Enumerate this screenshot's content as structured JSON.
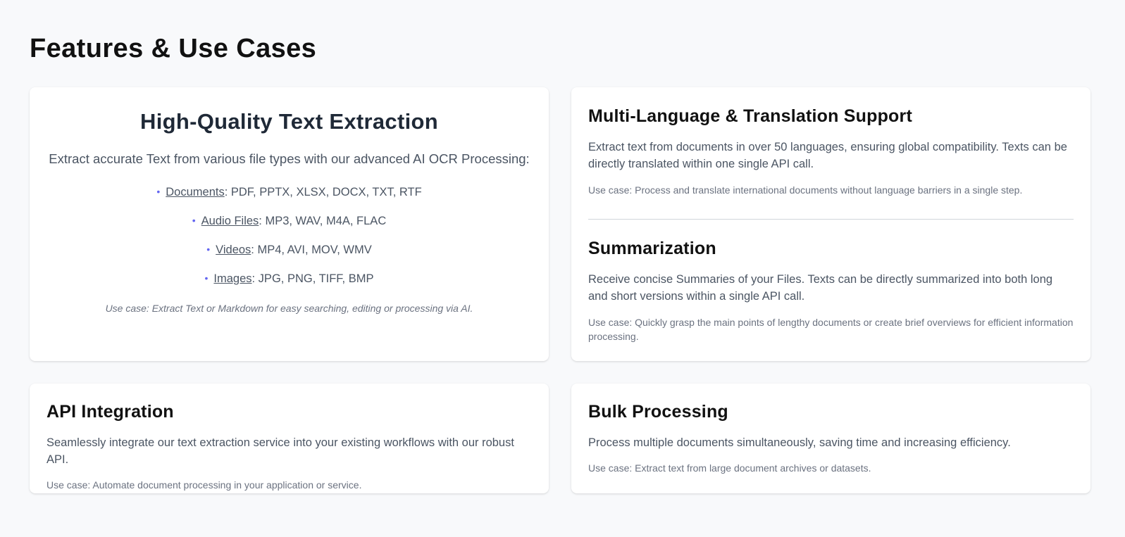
{
  "page": {
    "title": "Features & Use Cases"
  },
  "text_extraction": {
    "title": "High-Quality Text Extraction",
    "description": "Extract accurate Text from various file types with our advanced AI OCR Processing:",
    "file_types": [
      {
        "name": "Documents",
        "formats": ": PDF, PPTX, XLSX, DOCX, TXT, RTF"
      },
      {
        "name": "Audio Files",
        "formats": ": MP3, WAV, M4A, FLAC"
      },
      {
        "name": "Videos",
        "formats": ": MP4, AVI, MOV, WMV"
      },
      {
        "name": "Images",
        "formats": ": JPG, PNG, TIFF, BMP"
      }
    ],
    "bullet": "•",
    "use_case": "Use case: Extract Text or Markdown for easy searching, editing or processing via AI."
  },
  "multi_language": {
    "title": "Multi-Language & Translation Support",
    "description": "Extract text from documents in over 50 languages, ensuring global compatibility. Texts can be directly translated within one single API call.",
    "use_case": "Use case: Process and translate international documents without language barriers in a single step."
  },
  "summarization": {
    "title": "Summarization",
    "description": "Receive concise Summaries of your Files. Texts can be directly summarized into both long and short versions within a single API call.",
    "use_case": "Use case: Quickly grasp the main points of lengthy documents or create brief overviews for efficient information processing."
  },
  "api_integration": {
    "title": "API Integration",
    "description": "Seamlessly integrate our text extraction service into your existing workflows with our robust API.",
    "use_case": "Use case: Automate document processing in your application or service."
  },
  "bulk_processing": {
    "title": "Bulk Processing",
    "description": "Process multiple documents simultaneously, saving time and increasing efficiency.",
    "use_case": "Use case: Extract text from large document archives or datasets."
  },
  "colors": {
    "background": "#f8f9fb",
    "card": "#ffffff",
    "bullet": "#6366f1",
    "body_text": "#4b5563",
    "muted_text": "#6b7280"
  }
}
